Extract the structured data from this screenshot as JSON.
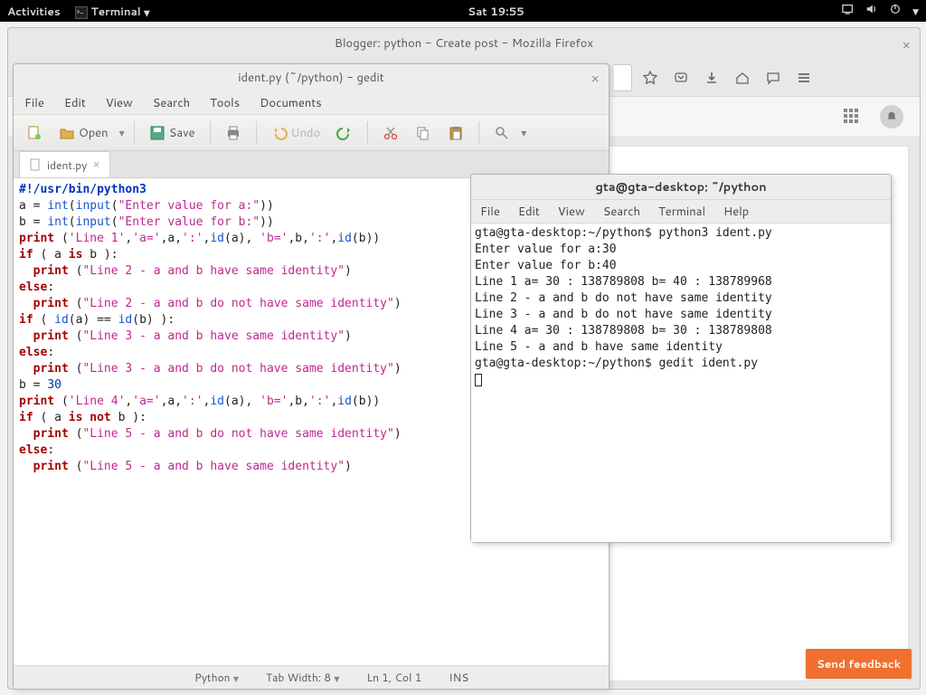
{
  "topbar": {
    "activities": "Activities",
    "terminal": "Terminal",
    "clock": "Sat 19:55"
  },
  "firefox": {
    "title": "Blogger: python - Create post - Mozilla Firefox"
  },
  "gedit": {
    "title": "ident.py (~/python) - gedit",
    "menus": {
      "file": "File",
      "edit": "Edit",
      "view": "View",
      "search": "Search",
      "tools": "Tools",
      "documents": "Documents"
    },
    "toolbar": {
      "open": "Open",
      "save": "Save",
      "undo": "Undo"
    },
    "tab": "ident.py",
    "status": {
      "lang": "Python",
      "tabwidth": "Tab Width: 8",
      "pos": "Ln 1, Col 1",
      "mode": "INS"
    },
    "code": {
      "shebang": "#!/usr/bin/python3",
      "l2a": "a = ",
      "l2b": "(",
      "l2c": "(",
      "l2d": "\"Enter value for a:\"",
      "l2e": "))",
      "l3a": "b = ",
      "l3b": "(",
      "l3c": "(",
      "l3d": "\"Enter value for b:\"",
      "l3e": "))",
      "int": "int",
      "input": "input",
      "print": "print",
      "id": "id",
      "if": "if",
      "else": "else",
      "is": "is",
      "not": "not",
      "p1a": " (",
      "p1b": "'Line 1'",
      "p1c": ",",
      "p1d": "'a='",
      "p1e": ",a,",
      "p1f": "':'",
      "p1g": ",",
      "p1h": "(a), ",
      "p1i": "'b='",
      "p1j": ",b,",
      "p1k": "':'",
      "p1l": ",",
      "p1m": "(b))",
      "if1": " ( a ",
      " if1b": " b ):",
      "p2": " (",
      "s2": "\"Line 2 - a and b have same identity\"",
      "p2e": ")",
      "elsec": ":",
      "p3": " (",
      "s3": "\"Line 2 - a and b do not have same identity\"",
      "p3e": ")",
      "if2a": " ( ",
      "if2b": "(a) == ",
      "if2c": "(b) ):",
      "p4": " (",
      "s4": "\"Line 3 - a and b have same identity\"",
      "p4e": ")",
      "p5": " (",
      "s5": "\"Line 3 - a and b do not have same identity\"",
      "p5e": ")",
      "b30": "b = ",
      "n30": "30",
      "p6a": " (",
      "p6b": "'Line 4'",
      "p6c": ",",
      "p6d": "'a='",
      "p6e": ",a,",
      "p6f": "':'",
      "p6g": ",",
      "p6h": "(a), ",
      "p6i": "'b='",
      "p6j": ",b,",
      "p6k": "':'",
      "p6l": ",",
      "p6m": "(b))",
      "if3a": " ( a ",
      "if3b": " b ):",
      "p7": " (",
      "s7": "\"Line 5 - a and b do not have same identity\"",
      "p7e": ")",
      "p8": " (",
      "s8": "\"Line 5 - a and b have same identity\"",
      "p8e": ")"
    }
  },
  "term": {
    "title": "gta@gta-desktop: ~/python",
    "menus": {
      "file": "File",
      "edit": "Edit",
      "view": "View",
      "search": "Search",
      "terminal": "Terminal",
      "help": "Help"
    },
    "output": "gta@gta-desktop:~/python$ python3 ident.py\nEnter value for a:30\nEnter value for b:40\nLine 1 a= 30 : 138789808 b= 40 : 138789968\nLine 2 - a and b do not have same identity\nLine 3 - a and b do not have same identity\nLine 4 a= 30 : 138789808 b= 30 : 138789808\nLine 5 - a and b have same identity\ngta@gta-desktop:~/python$ gedit ident.py"
  },
  "feedback": "Send feedback"
}
